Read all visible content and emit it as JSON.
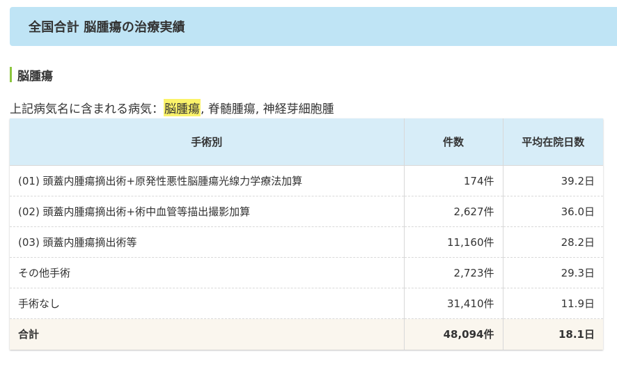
{
  "header": {
    "title": "全国合計 脳腫瘍の治療実績"
  },
  "section": {
    "title": "脳腫瘍"
  },
  "diseases": {
    "prefix": "上記病気名に含まれる病気：",
    "highlighted": "脳腫瘍",
    "rest": ", 脊髄腫瘍, 神経芽細胞腫"
  },
  "table": {
    "columns": [
      "手術別",
      "件数",
      "平均在院日数"
    ],
    "rows": [
      {
        "name": "(01) 頭蓋内腫瘍摘出術+原発性悪性脳腫瘍光線力学療法加算",
        "count": "174件",
        "days": "39.2日"
      },
      {
        "name": "(02) 頭蓋内腫瘍摘出術+術中血管等描出撮影加算",
        "count": "2,627件",
        "days": "36.0日"
      },
      {
        "name": "(03) 頭蓋内腫瘍摘出術等",
        "count": "11,160件",
        "days": "28.2日"
      },
      {
        "name": "その他手術",
        "count": "2,723件",
        "days": "29.3日"
      },
      {
        "name": "手術なし",
        "count": "31,410件",
        "days": "11.9日"
      }
    ],
    "total": {
      "name": "合計",
      "count": "48,094件",
      "days": "18.1日"
    }
  },
  "colors": {
    "header_band": "#bfe4f5",
    "table_header": "#d7edf8",
    "section_accent": "#8cc63f",
    "highlight": "#fbf36a",
    "total_row": "#faf6ee"
  }
}
